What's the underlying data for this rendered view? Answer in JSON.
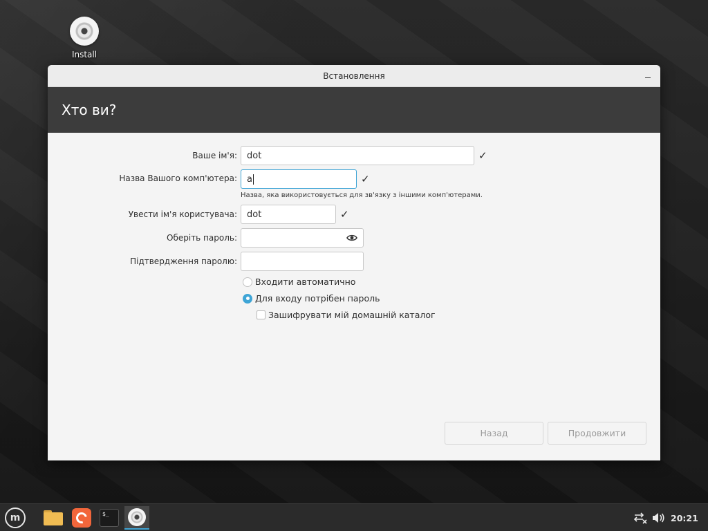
{
  "desktop": {
    "install_label": "Install"
  },
  "window": {
    "title": "Встановлення",
    "minimize_glyph": "–",
    "header_title": "Хто ви?"
  },
  "form": {
    "name": {
      "label": "Ваше ім'я:",
      "value": "dot",
      "valid_mark": "✓"
    },
    "computer": {
      "label": "Назва Вашого комп'ютера:",
      "value": "a",
      "valid_mark": "✓",
      "hint": "Назва, яка використовується для зв'язку з іншими комп'ютерами."
    },
    "username": {
      "label": "Увести ім'я користувача:",
      "value": "dot",
      "valid_mark": "✓"
    },
    "password": {
      "label": "Оберіть пароль:",
      "value": ""
    },
    "confirm": {
      "label": "Підтвердження паролю:",
      "value": ""
    },
    "login_auto": {
      "label": "Входити автоматично",
      "selected": false
    },
    "login_password": {
      "label": "Для входу потрібен пароль",
      "selected": true
    },
    "encrypt_home": {
      "label": "Зашифрувати мій домашній каталог",
      "checked": false
    }
  },
  "buttons": {
    "back": "Назад",
    "continue": "Продовжити"
  },
  "taskbar": {
    "terminal_glyph": "$_",
    "clock": "20:21"
  },
  "colors": {
    "accent": "#3fa5d6",
    "header_bg": "#3c3c3c"
  }
}
